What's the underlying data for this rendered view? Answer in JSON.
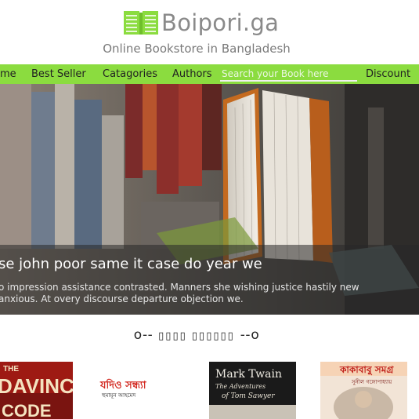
{
  "header": {
    "logo_text": "Boipori.ga",
    "tagline": "Online Bookstore in Bangladesh",
    "logo_icon": "open-book-icon",
    "brand_color": "#8bdc3f"
  },
  "nav": {
    "items": [
      "me",
      "Best Seller",
      "Catagories",
      "Authors"
    ],
    "search_placeholder": "Search your Book here",
    "discount": "Discount"
  },
  "hero": {
    "title": "se john poor same it case do year we",
    "text": "o impression assistance contrasted. Manners she wishing justice hastily new anxious. At overy discourse departure objection we."
  },
  "section": {
    "title_left": "o--",
    "title_mid": "▯▯▯▯ ▯▯▯▯▯▯",
    "title_right": "--o"
  },
  "books": [
    {
      "title_line1": "THE",
      "title_line2": "DAVINCI",
      "title_line3": "CODE"
    },
    {
      "title": "যদিও সন্ধ্যা",
      "author": "হুমায়ূন আহমেদ"
    },
    {
      "title": "Mark Twain",
      "subtitle": "The Adventures",
      "subtitle2": "of Tom Sawyer"
    },
    {
      "title": "কাকাবাবু সমগ্র",
      "author": "সুনীল গঙ্গোপাধ্যায়"
    }
  ]
}
